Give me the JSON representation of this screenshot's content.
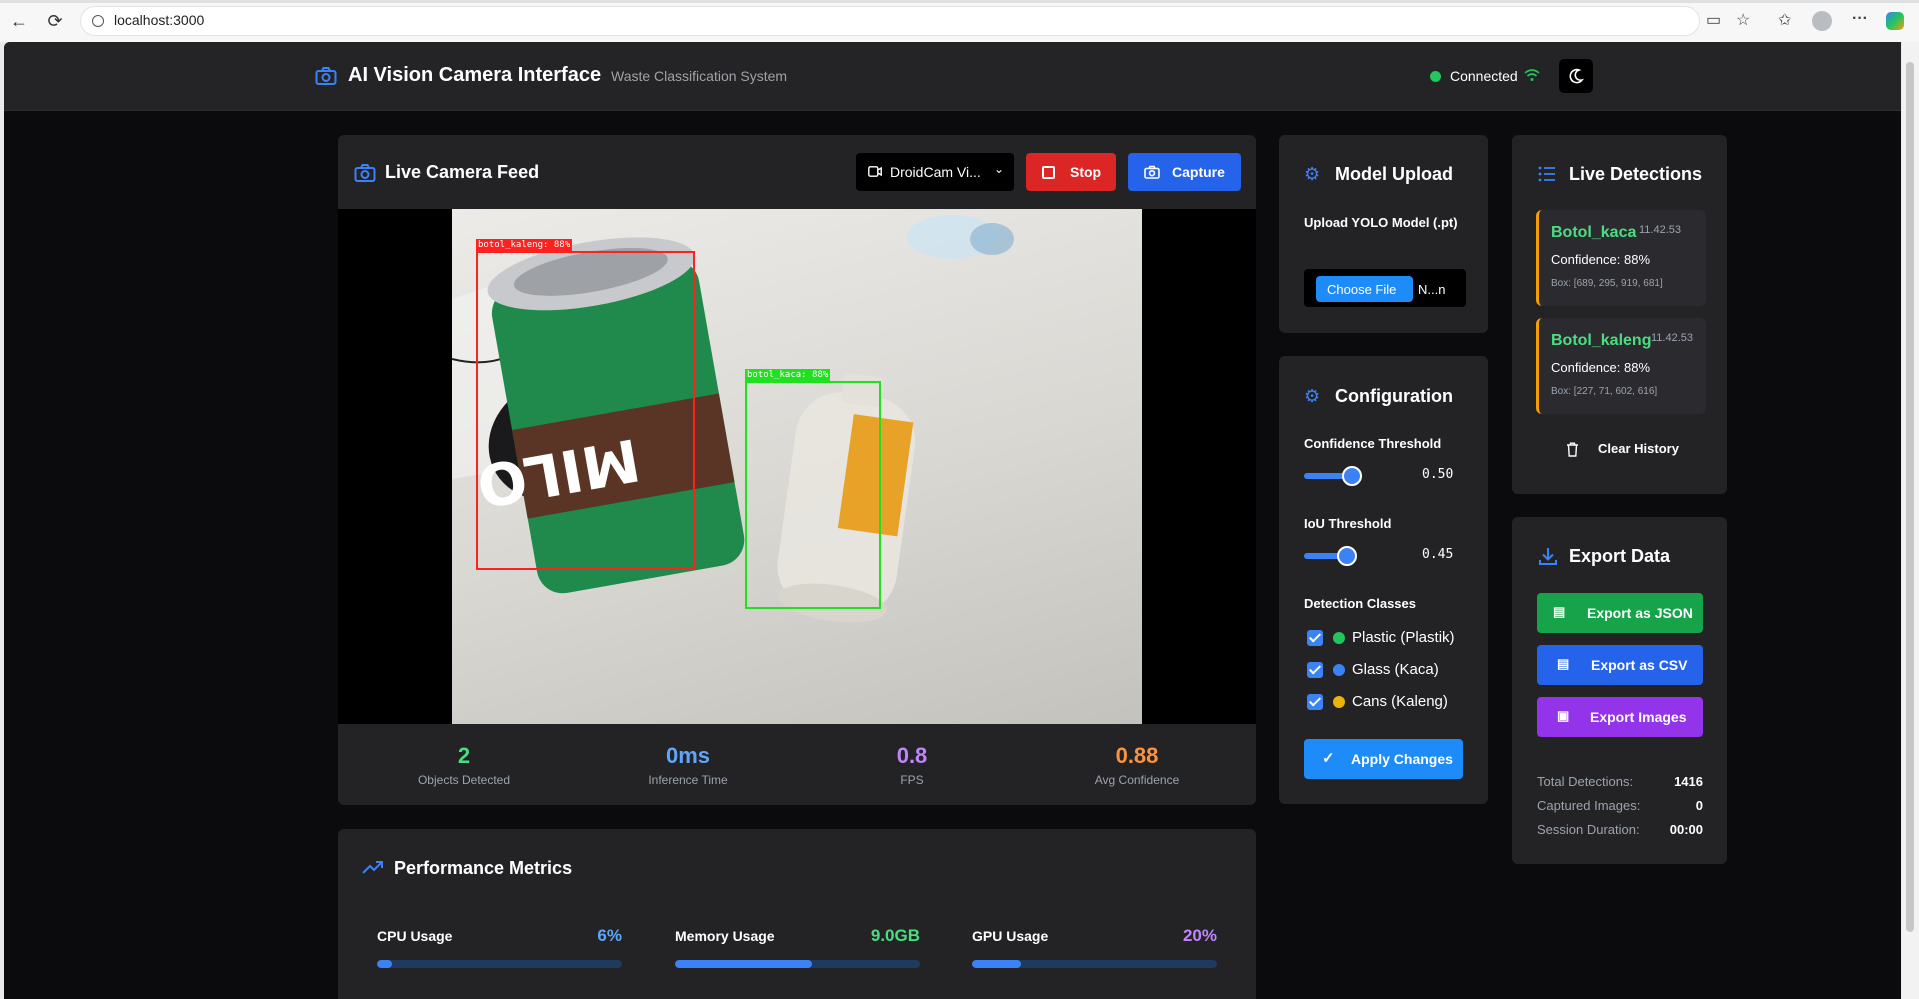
{
  "browser": {
    "url": "localhost:3000"
  },
  "header": {
    "title": "AI Vision Camera Interface",
    "subtitle": "Waste Classification System",
    "status": "Connected"
  },
  "camera": {
    "title": "Live Camera Feed",
    "device": "DroidCam Vi...",
    "stop_label": "Stop",
    "capture_label": "Capture",
    "boxes": [
      {
        "label": "botol_kaleng: 88%",
        "color": "#ff2020"
      },
      {
        "label": "botol_kaca: 88%",
        "color": "#20e020"
      }
    ],
    "stats": [
      {
        "value": "2",
        "label": "Objects Detected",
        "color": "#4ade80"
      },
      {
        "value": "0ms",
        "label": "Inference Time",
        "color": "#60a5fa"
      },
      {
        "value": "0.8",
        "label": "FPS",
        "color": "#c084fc"
      },
      {
        "value": "0.88",
        "label": "Avg Confidence",
        "color": "#fb923c"
      }
    ]
  },
  "performance": {
    "title": "Performance Metrics",
    "metrics": [
      {
        "label": "CPU Usage",
        "value": "6%",
        "fraction": 0.06,
        "color": "#60a5fa"
      },
      {
        "label": "Memory Usage",
        "value": "9.0GB",
        "fraction": 0.56,
        "color": "#4ade80"
      },
      {
        "label": "GPU Usage",
        "value": "20%",
        "fraction": 0.2,
        "color": "#c084fc"
      }
    ]
  },
  "model_upload": {
    "title": "Model Upload",
    "label": "Upload YOLO Model (.pt)",
    "choose_file": "Choose File",
    "file_name": "N...n"
  },
  "config": {
    "title": "Configuration",
    "confidence_label": "Confidence Threshold",
    "confidence_value": "0.50",
    "confidence_fraction": 0.5,
    "iou_label": "IoU Threshold",
    "iou_value": "0.45",
    "iou_fraction": 0.45,
    "classes_label": "Detection Classes",
    "classes": [
      {
        "label": "Plastic (Plastik)",
        "color": "#22c55e",
        "checked": true
      },
      {
        "label": "Glass (Kaca)",
        "color": "#3b82f6",
        "checked": true
      },
      {
        "label": "Cans (Kaleng)",
        "color": "#eab308",
        "checked": true
      }
    ],
    "apply_label": "Apply Changes"
  },
  "detections": {
    "title": "Live Detections",
    "items": [
      {
        "name": "Botol_kaca",
        "time": "11.42.53",
        "confidence": "Confidence: 88%",
        "box": "Box: [689, 295, 919, 681]"
      },
      {
        "name": "Botol_kaleng",
        "time": "11.42.53",
        "confidence": "Confidence: 88%",
        "box": "Box: [227, 71, 602, 616]"
      }
    ],
    "clear_label": "Clear History"
  },
  "export": {
    "title": "Export Data",
    "json_label": "Export as JSON",
    "csv_label": "Export as CSV",
    "images_label": "Export Images",
    "stats": [
      {
        "label": "Total Detections:",
        "value": "1416"
      },
      {
        "label": "Captured Images:",
        "value": "0"
      },
      {
        "label": "Session Duration:",
        "value": "00:00"
      }
    ]
  },
  "colors": {
    "accent": "#2563eb",
    "stop": "#dc2626",
    "export_json": "#16a34a",
    "export_csv": "#2563eb",
    "export_images": "#9333ea",
    "connected": "#22c55e"
  }
}
